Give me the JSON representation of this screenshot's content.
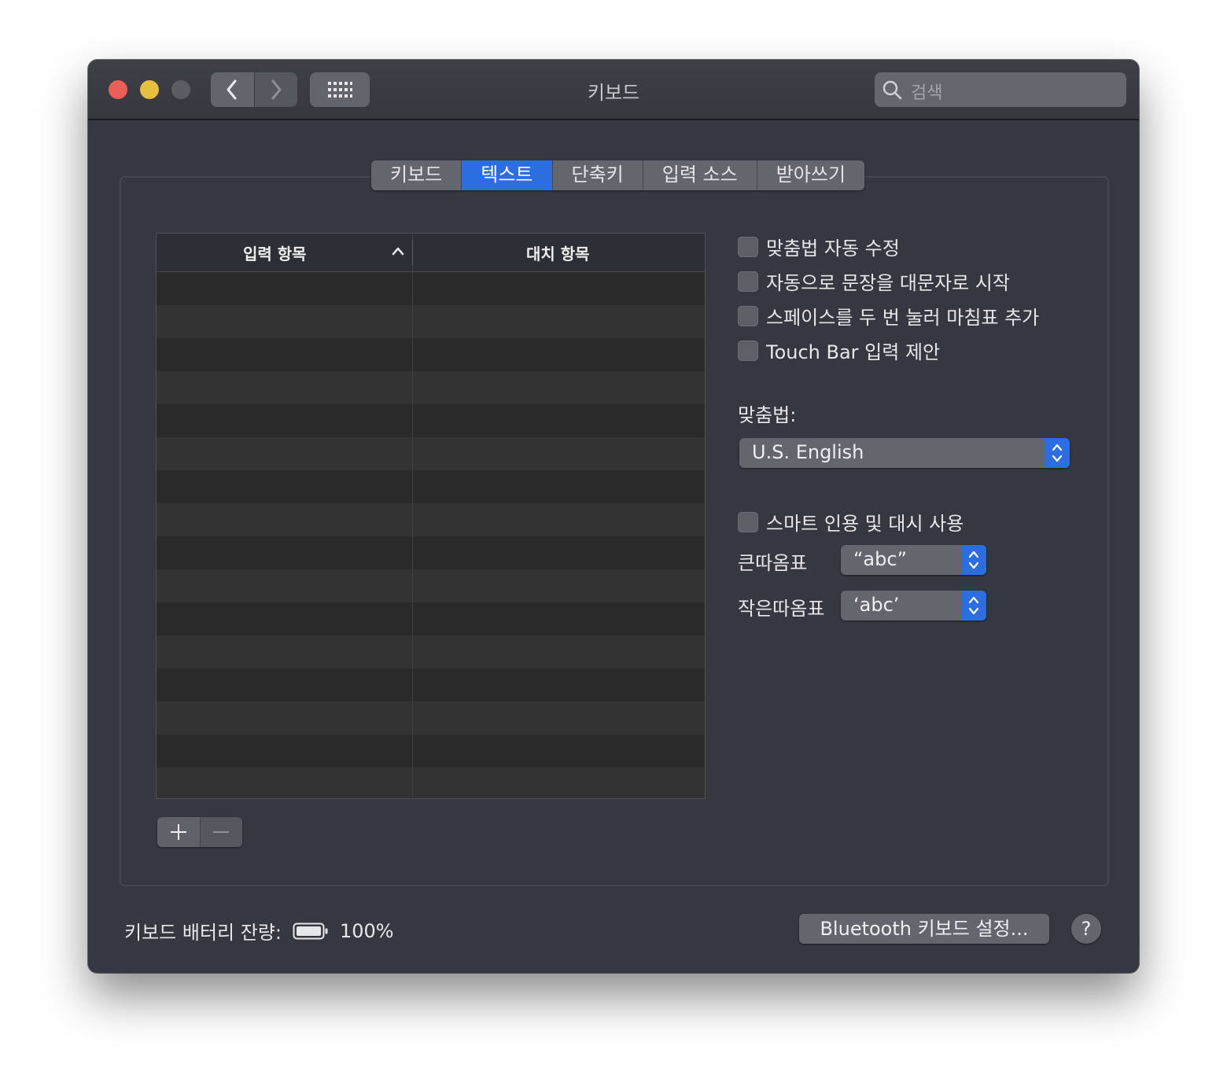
{
  "window": {
    "title": "키보드",
    "search_placeholder": "검색"
  },
  "tabs": [
    {
      "label": "키보드",
      "active": false
    },
    {
      "label": "텍스트",
      "active": true
    },
    {
      "label": "단축키",
      "active": false
    },
    {
      "label": "입력 소스",
      "active": false
    },
    {
      "label": "받아쓰기",
      "active": false
    }
  ],
  "table": {
    "col_input": "입력 항목",
    "col_replace": "대치 항목",
    "sort": "ascending",
    "rows": []
  },
  "options": {
    "auto_correct": {
      "label": "맞춤법 자동 수정",
      "checked": false
    },
    "auto_capitalize": {
      "label": "자동으로 문장을 대문자로 시작",
      "checked": false
    },
    "double_space_period": {
      "label": "스페이스를 두 번 눌러 마침표 추가",
      "checked": false
    },
    "touch_bar_suggestions": {
      "label": "Touch Bar 입력 제안",
      "checked": false
    }
  },
  "spelling": {
    "label": "맞춤법:",
    "value": "U.S. English"
  },
  "smart_quotes": {
    "label": "스마트 인용 및 대시 사용",
    "checked": false,
    "double_label": "큰따옴표",
    "double_value": "“abc”",
    "single_label": "작은따옴표",
    "single_value": "‘abc’"
  },
  "footer": {
    "battery_label": "키보드 배터리 잔량:",
    "battery_value": "100%",
    "bluetooth_button": "Bluetooth 키보드 설정...",
    "help": "?"
  },
  "colors": {
    "accent": "#2c6de0",
    "window_bg": "#353840"
  },
  "icons": [
    "back-chevron-icon",
    "forward-chevron-icon",
    "grid-icon",
    "search-icon",
    "sort-ascending-icon",
    "plus-icon",
    "minus-icon",
    "battery-icon",
    "popup-arrows-icon"
  ]
}
